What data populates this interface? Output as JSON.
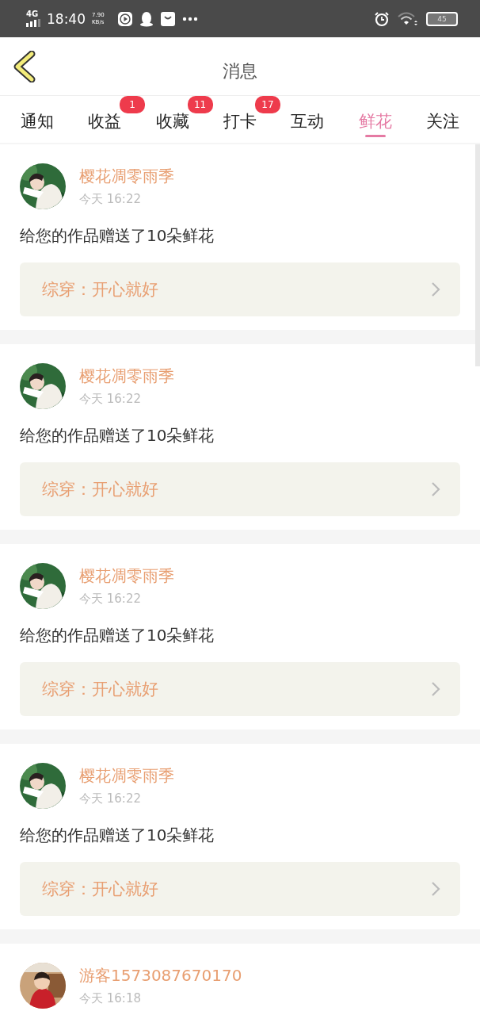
{
  "status_bar": {
    "network": "4G",
    "time": "18:40",
    "speed": "7.90",
    "speed_unit": "KB/s",
    "battery": "45"
  },
  "header": {
    "title": "消息"
  },
  "tabs": [
    {
      "label": "通知",
      "selected": false
    },
    {
      "label": "收益",
      "selected": false,
      "badge": "1"
    },
    {
      "label": "收藏",
      "selected": false,
      "badge": "11"
    },
    {
      "label": "打卡",
      "selected": false,
      "badge": "17"
    },
    {
      "label": "互动",
      "selected": false
    },
    {
      "label": "鲜花",
      "selected": true
    },
    {
      "label": "关注",
      "selected": false
    }
  ],
  "messages": [
    {
      "user": "樱花凋零雨季",
      "time": "今天 16:22",
      "text": "给您的作品赠送了10朵鲜花",
      "work": "综穿：开心就好"
    },
    {
      "user": "樱花凋零雨季",
      "time": "今天 16:22",
      "text": "给您的作品赠送了10朵鲜花",
      "work": "综穿：开心就好"
    },
    {
      "user": "樱花凋零雨季",
      "time": "今天 16:22",
      "text": "给您的作品赠送了10朵鲜花",
      "work": "综穿：开心就好"
    },
    {
      "user": "樱花凋零雨季",
      "time": "今天 16:22",
      "text": "给您的作品赠送了10朵鲜花",
      "work": "综穿：开心就好"
    },
    {
      "user": "游客1573087670170",
      "time": "今天 16:18"
    }
  ]
}
